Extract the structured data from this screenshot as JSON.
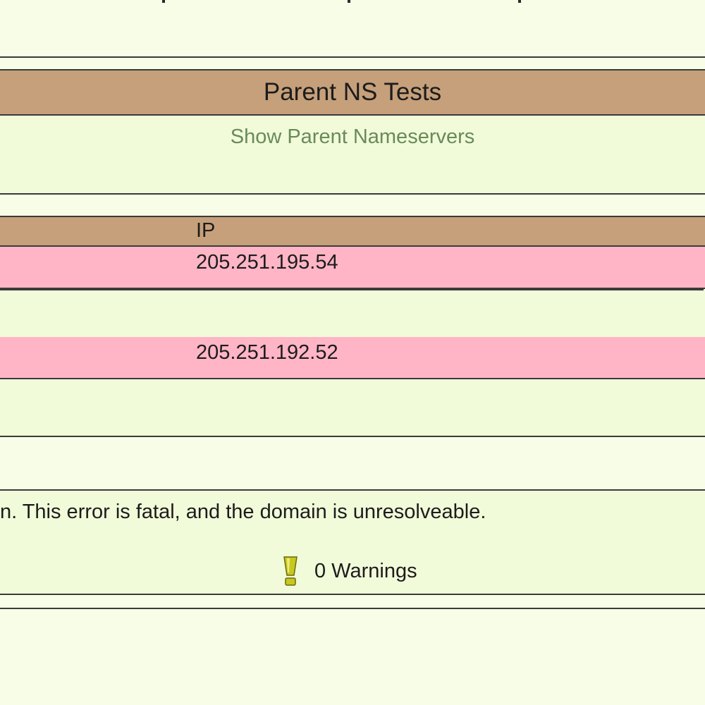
{
  "parent_ns_section": {
    "title": "Parent NS Tests",
    "show_link": "Show Parent Nameservers"
  },
  "ip_table": {
    "header": "IP",
    "rows": [
      {
        "ip": "205.251.195.54",
        "status": "error"
      },
      {
        "ip": "205.251.192.52",
        "status": "error"
      }
    ]
  },
  "result": {
    "error_text": "n. This error is fatal, and the domain is unresolveable.",
    "warnings_label": "0 Warnings",
    "warning_icon": "exclamation-warning-icon"
  },
  "colors": {
    "page_bg": "#f7fde6",
    "section_bg": "#f1fbd9",
    "header_bg": "#c6a07a",
    "error_row_bg": "#ffb5c6",
    "link_color": "#6a8a5a",
    "warning_icon": "#c8c81e"
  }
}
